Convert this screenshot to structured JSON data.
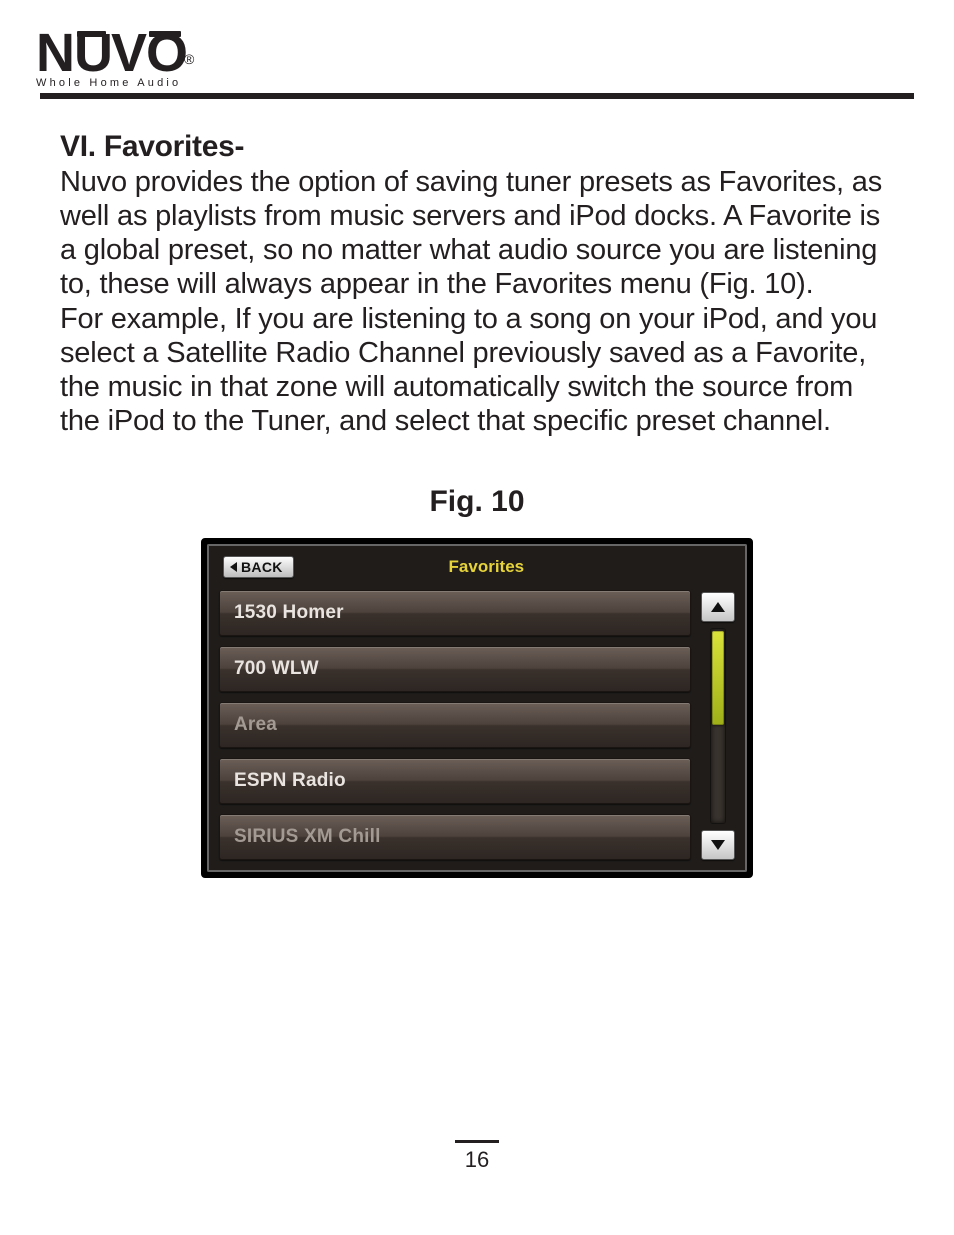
{
  "logo": {
    "brand_letters": [
      "N",
      "U",
      "V",
      "O"
    ],
    "registered": "®",
    "tagline": "Whole Home Audio"
  },
  "section": {
    "heading": "VI. Favorites-",
    "para1": "Nuvo provides the option of saving tuner presets as Favorites, as well as playlists from music servers and iPod docks.  A Favorite is a global preset, so no matter what audio source you are listening to, these will always appear in the Favorites menu (Fig. 10).",
    "para2": "For example, If you are listening to a song on your iPod, and you select a Satellite Radio Channel previously saved as a Favorite, the music in that zone will automatically switch the source from the iPod to the Tuner, and select that specific preset channel."
  },
  "figure": {
    "caption": "Fig. 10",
    "back_label": "BACK",
    "title": "Favorites",
    "items": [
      {
        "label": "1530 Homer",
        "dim": false
      },
      {
        "label": "700 WLW",
        "dim": false
      },
      {
        "label": "Area",
        "dim": true
      },
      {
        "label": "ESPN Radio",
        "dim": false
      },
      {
        "label": "SIRIUS XM Chill",
        "dim": true
      }
    ]
  },
  "page_number": "16"
}
